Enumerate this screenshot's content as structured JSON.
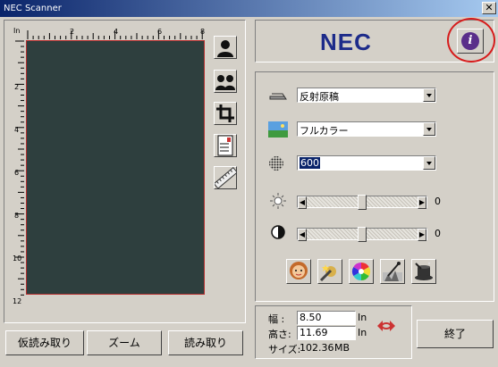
{
  "window": {
    "title": "NEC Scanner",
    "close_label": "✕"
  },
  "preview": {
    "unit": "In",
    "top_ticks": [
      "2",
      "4",
      "6",
      "8"
    ],
    "left_ticks": [
      "2",
      "4",
      "6",
      "8",
      "10",
      "12"
    ]
  },
  "tools": [
    "portrait-icon",
    "duo-portrait-icon",
    "crop-icon",
    "paper-size-icon",
    "ruler-icon"
  ],
  "logo": {
    "text": "NEC"
  },
  "info": {
    "label": "i"
  },
  "settings": {
    "source": {
      "value": "反射原稿"
    },
    "color_mode": {
      "value": "フルカラー"
    },
    "resolution": {
      "value": "600"
    },
    "brightness": {
      "value": "0",
      "level": 0.5
    },
    "contrast": {
      "value": "0",
      "level": 0.5
    }
  },
  "size": {
    "width_label": "幅 :",
    "width_value": "8.50",
    "width_unit": "In",
    "height_label": "高さ:",
    "height_value": "11.69",
    "height_unit": "In",
    "size_label": "サイズ:",
    "size_value": "102.36",
    "size_unit": "MB"
  },
  "buttons": {
    "prescan": "仮読み取り",
    "zoom": "ズーム",
    "scan": "読み取り",
    "exit": "終了"
  }
}
